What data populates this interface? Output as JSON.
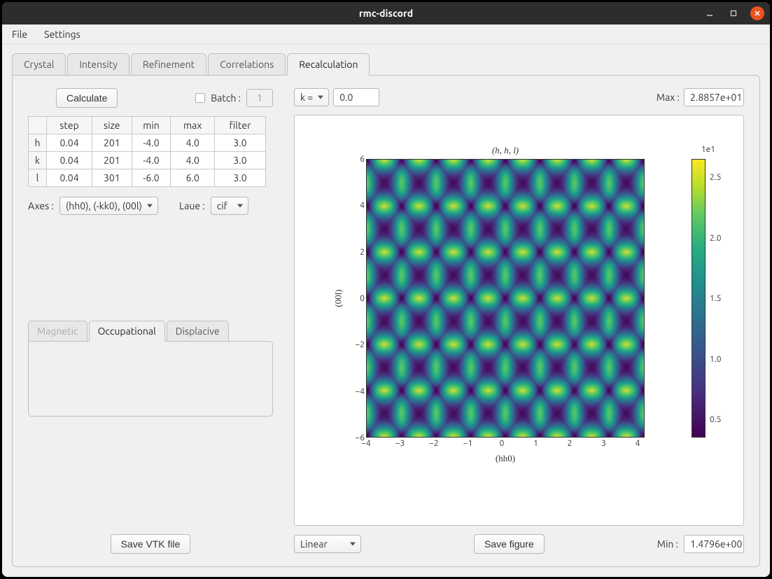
{
  "window": {
    "title": "rmc-discord",
    "menus": [
      "File",
      "Settings"
    ]
  },
  "tabs": [
    "Crystal",
    "Intensity",
    "Refinement",
    "Correlations",
    "Recalculation"
  ],
  "active_tab": "Recalculation",
  "controls": {
    "calculate": "Calculate",
    "batch_label": "Batch :",
    "batch_value": "1",
    "axes_label": "Axes :",
    "axes_value": "(hh0), (-kk0), (00l)",
    "laue_label": "Laue :",
    "laue_value": "cif",
    "save_vtk": "Save VTK file",
    "k_label": "k =",
    "k_value": "0.0",
    "max_label": "Max :",
    "max_value": "2.8857e+01",
    "scale_value": "Linear",
    "save_figure": "Save figure",
    "min_label": "Min :",
    "min_value": "1.4796e+00"
  },
  "grid": {
    "headers": [
      "step",
      "size",
      "min",
      "max",
      "filter"
    ],
    "rows": [
      {
        "label": "h",
        "step": "0.04",
        "size": "201",
        "min": "-4.0",
        "max": "4.0",
        "filter": "3.0"
      },
      {
        "label": "k",
        "step": "0.04",
        "size": "201",
        "min": "-4.0",
        "max": "4.0",
        "filter": "3.0"
      },
      {
        "label": "l",
        "step": "0.04",
        "size": "301",
        "min": "-6.0",
        "max": "6.0",
        "filter": "3.0"
      }
    ]
  },
  "subtabs": {
    "items": [
      "Magnetic",
      "Occupational",
      "Displacive"
    ],
    "active": "Occupational",
    "disabled": "Magnetic"
  },
  "chart_data": {
    "type": "heatmap",
    "title": "(h, h, l)",
    "xlabel": "(hh0)",
    "ylabel": "(00l)",
    "xlim": [
      -4,
      4
    ],
    "ylim": [
      -6,
      6
    ],
    "xticks": [
      "−4",
      "−3",
      "−2",
      "−1",
      "0",
      "1",
      "2",
      "3",
      "4"
    ],
    "yticks": [
      "−6",
      "−4",
      "−2",
      "0",
      "2",
      "4",
      "6"
    ],
    "colorbar": {
      "label": "1e1",
      "ticks": [
        "2.5",
        "2.0",
        "1.5",
        "1.0",
        "0.5"
      ],
      "range": [
        0.14796,
        2.8857
      ],
      "cmap": "viridis"
    },
    "note": "Intensity map periodic with maxima near integer (hh0,00l); bow-tie shaped bright regions centered on each integer node."
  }
}
